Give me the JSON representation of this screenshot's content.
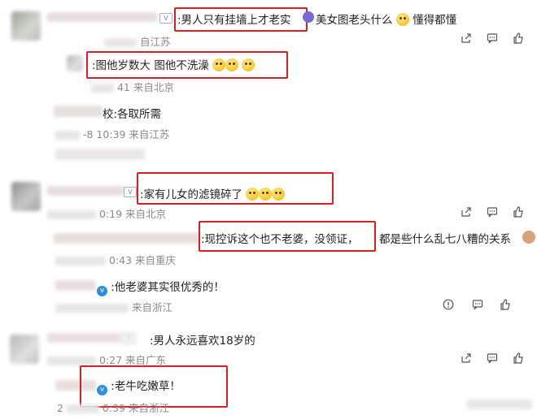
{
  "comments": [
    {
      "text": ":男人只有挂墙上才老实",
      "text2": "美女图老头什么",
      "text3": "懂得都懂",
      "meta": "自江苏"
    },
    {
      "text": ":图他岁数大 图他不洗澡",
      "meta": "41 来自北京"
    },
    {
      "text": "校:各取所需",
      "meta": "-8 10:39 来自江苏"
    },
    {
      "text": ":家有儿女的滤镜碎了",
      "meta": "0:19 来自北京"
    },
    {
      "text": ":现控诉这个也不老婆，没领证，",
      "text2": "都是些什么乱七八糟的关系",
      "meta": "0:43 来自重庆"
    },
    {
      "text": ":他老婆其实很优秀的！",
      "meta": "来自浙江"
    },
    {
      "text": ":男人永远喜欢18岁的",
      "meta": "0:27 来自广东"
    },
    {
      "text": ":老牛吃嫩草！",
      "meta": "0:39 来自浙江",
      "prefix": "2"
    }
  ],
  "icons": {
    "share": "share-icon",
    "comment": "comment-icon",
    "like": "like-icon",
    "report": "report-icon"
  },
  "colors": {
    "highlight_box": "#d92020",
    "meta_text": "#8a8a8a",
    "verified_badge": "#2a8fe0"
  }
}
